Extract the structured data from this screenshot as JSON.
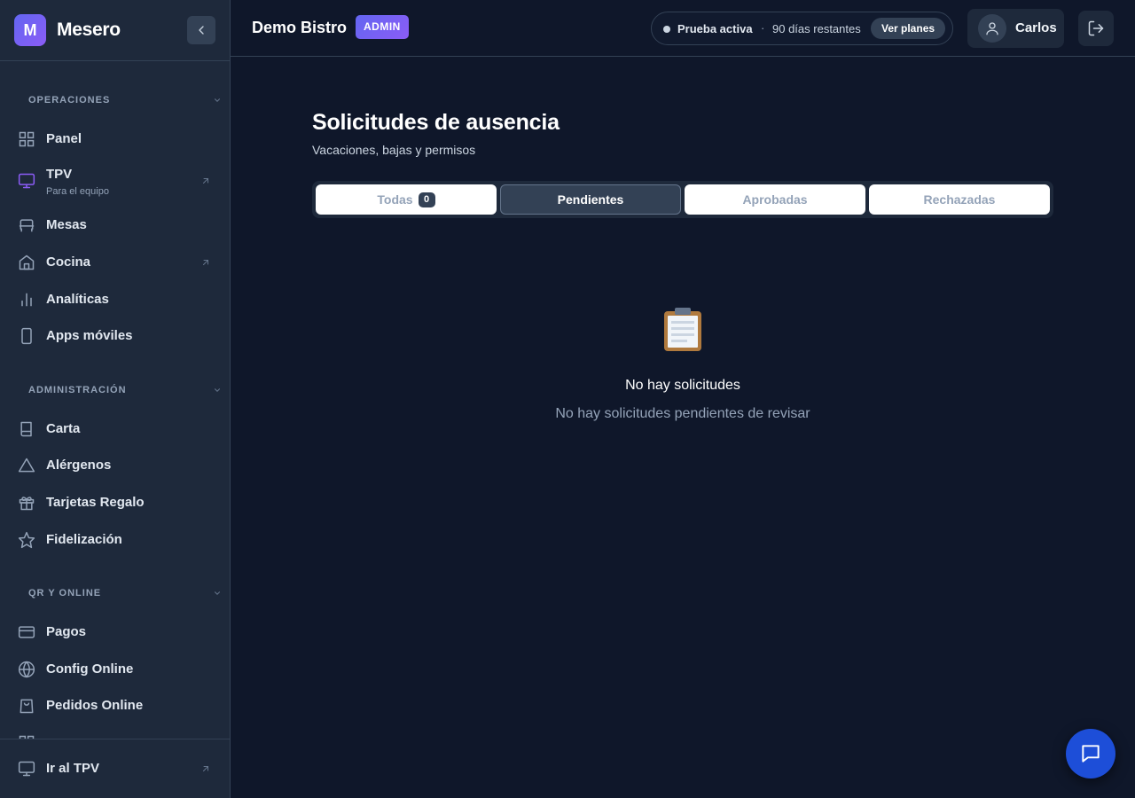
{
  "app": {
    "logo_letter": "M",
    "name": "Mesero"
  },
  "sidebar": {
    "sections": [
      {
        "label": "OPERACIONES",
        "items": [
          {
            "label": "Panel",
            "icon": "grid-icon"
          },
          {
            "label": "TPV",
            "sublabel": "Para el equipo",
            "icon": "monitor-icon",
            "external": true
          },
          {
            "label": "Mesas",
            "icon": "table-icon"
          },
          {
            "label": "Cocina",
            "icon": "home-icon",
            "external": true
          },
          {
            "label": "Analíticas",
            "icon": "bar-chart-icon"
          },
          {
            "label": "Apps móviles",
            "icon": "smartphone-icon"
          }
        ]
      },
      {
        "label": "ADMINISTRACIÓN",
        "items": [
          {
            "label": "Carta",
            "icon": "book-icon"
          },
          {
            "label": "Alérgenos",
            "icon": "alert-triangle-icon"
          },
          {
            "label": "Tarjetas Regalo",
            "icon": "gift-icon"
          },
          {
            "label": "Fidelización",
            "icon": "star-icon"
          }
        ]
      },
      {
        "label": "QR Y ONLINE",
        "items": [
          {
            "label": "Pagos",
            "icon": "credit-card-icon"
          },
          {
            "label": "Config Online",
            "icon": "globe-icon"
          },
          {
            "label": "Pedidos Online",
            "icon": "shopping-bag-icon"
          }
        ]
      }
    ],
    "footer": {
      "label": "Ir al TPV",
      "icon": "monitor-icon",
      "external": true
    }
  },
  "topbar": {
    "restaurant": "Demo Bistro",
    "role_badge": "ADMIN",
    "trial": {
      "status": "Prueba activa",
      "separator": "·",
      "days": "90 días restantes",
      "cta": "Ver planes"
    },
    "user": {
      "name": "Carlos"
    }
  },
  "main": {
    "title": "Solicitudes de ausencia",
    "subtitle": "Vacaciones, bajas y permisos",
    "tabs": [
      {
        "label": "Todas",
        "count": "0"
      },
      {
        "label": "Pendientes",
        "active": true
      },
      {
        "label": "Aprobadas"
      },
      {
        "label": "Rechazadas"
      }
    ],
    "empty": {
      "icon": "clipboard-icon",
      "title": "No hay solicitudes",
      "subtitle": "No hay solicitudes pendientes de revisar"
    }
  },
  "colors": {
    "background": "#0f172a",
    "sidebar": "#1e293b",
    "accent": "#6366f1",
    "chat_button": "#1d4ed8"
  }
}
